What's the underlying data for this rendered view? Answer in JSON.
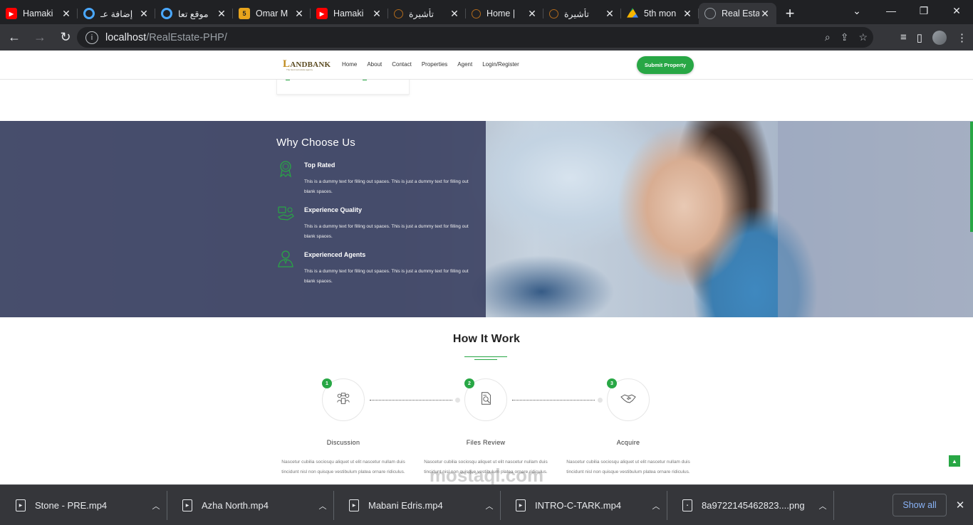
{
  "browser": {
    "tabs": [
      {
        "title": "Hamaki",
        "favicon": "youtube-icon",
        "color": "#ff0000"
      },
      {
        "title": "إضافة عـ",
        "favicon": "circle-app-icon",
        "color": "#4aa8ff"
      },
      {
        "title": "موقع تعا",
        "favicon": "circle-app-icon",
        "color": "#4aa8ff"
      },
      {
        "title": "Omar M",
        "favicon": "number-5-icon",
        "color": "#e8a41c",
        "glyph": "5"
      },
      {
        "title": "Hamaki",
        "favicon": "youtube-icon",
        "color": "#ff0000"
      },
      {
        "title": "تأشيرة",
        "favicon": "loading-ring-icon",
        "color": "#b06a1c"
      },
      {
        "title": "Home |",
        "favicon": "loading-ring-icon",
        "color": "#b06a1c"
      },
      {
        "title": "تأشيرة",
        "favicon": "loading-ring-icon",
        "color": "#b06a1c"
      },
      {
        "title": "5th mon",
        "favicon": "google-drive-icon",
        "color": "#1fa463"
      },
      {
        "title": "Real Esta",
        "favicon": "globe-icon",
        "color": "#9aa0a6",
        "active": true
      }
    ],
    "new_tab_glyph": "+",
    "url_host": "localhost",
    "url_path": "/RealEstate-PHP/"
  },
  "site": {
    "logo": {
      "prefix": "L",
      "text": "ANDBANK",
      "tagline": "The best real estate agency"
    },
    "nav": [
      "Home",
      "About",
      "Contact",
      "Properties",
      "Agent",
      "Login/Register"
    ],
    "cta": "Submit Property",
    "why": {
      "title": "Why Choose Us",
      "features": [
        {
          "title": "Top Rated",
          "icon": "award-medal-icon",
          "desc": "This is a dummy text for filling out spaces. This is just a dummy text for filling out blank spaces."
        },
        {
          "title": "Experience Quality",
          "icon": "quality-hand-icon",
          "desc": "This is a dummy text for filling out spaces. This is just a dummy text for filling out blank spaces."
        },
        {
          "title": "Experienced Agents",
          "icon": "agent-person-icon",
          "desc": "This is a dummy text for filling out spaces. This is just a dummy text for filling out blank spaces."
        }
      ]
    },
    "how": {
      "title": "How It Work",
      "steps": [
        {
          "num": "1",
          "label": "Discussion",
          "icon": "discussion-icon",
          "desc": "Nascetur cubilia sociosqu aliquet ut elit nascetur nullam duis tincidunt nisl non quisque vestibulum platea ornare ridiculus."
        },
        {
          "num": "2",
          "label": "Files Review",
          "icon": "file-review-icon",
          "desc": "Nascetur cubilia sociosqu aliquet ut elit nascetur nullam duis tincidunt nisl non quisque vestibulum platea ornare ridiculus."
        },
        {
          "num": "3",
          "label": "Acquire",
          "icon": "handshake-icon",
          "desc": "Nascetur cubilia sociosqu aliquet ut elit nascetur nullam duis tincidunt nisl non quisque vestibulum platea ornare ridiculus."
        }
      ]
    },
    "watermark": "mostaql.com",
    "accent": "#28a745"
  },
  "downloads": {
    "items": [
      "Stone - PRE.mp4",
      "Azha North.mp4",
      "Mabani Edris.mp4",
      "INTRO-C-TARK.mp4",
      "8a9722145462823....png"
    ],
    "show_all": "Show all"
  }
}
